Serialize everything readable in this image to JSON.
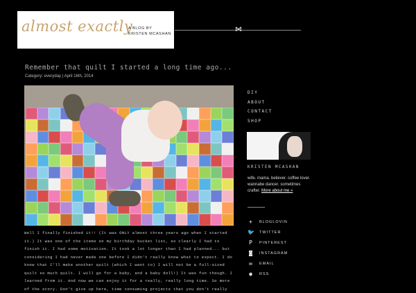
{
  "header": {
    "logo_script": "almost exactly",
    "logo_subtitle": "A BLOG BY KRISTEN MCASHAN"
  },
  "post": {
    "title": "Remember that quilt I started a long time ago...",
    "meta": "Category: everyday | April 16th, 2014",
    "body": "Well I finally finished it!! (It was ONLY almost three years ago when I started it.) It was one of the items on my birthday bucket list, so clearly I had to finish it. I had some motivation. It took a lot longer than I had planned... but considering I had never made one before I didn't really know what to expect. I do know that I'll make another quilt (which I want to) I will not be a full-sized quilt so much quilt. I will go for a baby, and a baby doll!) It was fun though. I learned from it. And now we can enjoy it for a really, really long time. So more of the story. Don't give up here, time consuming projects that you don't really",
    "image_alt": "Baby lying on a patchwork quilt"
  },
  "nav": {
    "items": [
      "DIY",
      "ABOUT",
      "CONTACT",
      "SHOP"
    ]
  },
  "profile": {
    "name": "KRISTEN MCASHAN",
    "bio": "wife. mama. believer. coffee lover. wannabe dancer. sometimes crafter.",
    "more_link": "More about me »"
  },
  "social": {
    "items": [
      {
        "label": "BLOGLOVIN",
        "icon": "bloglovin-icon",
        "glyph": "+"
      },
      {
        "label": "TWITTER",
        "icon": "twitter-icon",
        "glyph": "🐦"
      },
      {
        "label": "PINTEREST",
        "icon": "pinterest-icon",
        "glyph": "P"
      },
      {
        "label": "INSTAGRAM",
        "icon": "instagram-icon",
        "glyph": "◙"
      },
      {
        "label": "EMAIL",
        "icon": "email-icon",
        "glyph": "✉"
      },
      {
        "label": "RSS",
        "icon": "rss-icon",
        "glyph": "◉"
      }
    ]
  },
  "colors": {
    "background": "#000000",
    "logo_accent": "#c7a36f",
    "quilt": [
      "#e05a7a",
      "#7dc5c2",
      "#f2a33a",
      "#6b7fd6",
      "#9bd45b",
      "#e8e35c",
      "#d94d4d",
      "#b58ad8",
      "#f0f0f0",
      "#55b5e6",
      "#f6b6c6",
      "#7bc97b",
      "#c96d34",
      "#f27fb8",
      "#8ed0ea",
      "#ff9f5a",
      "#a1e06c",
      "#5e8ee0"
    ]
  }
}
